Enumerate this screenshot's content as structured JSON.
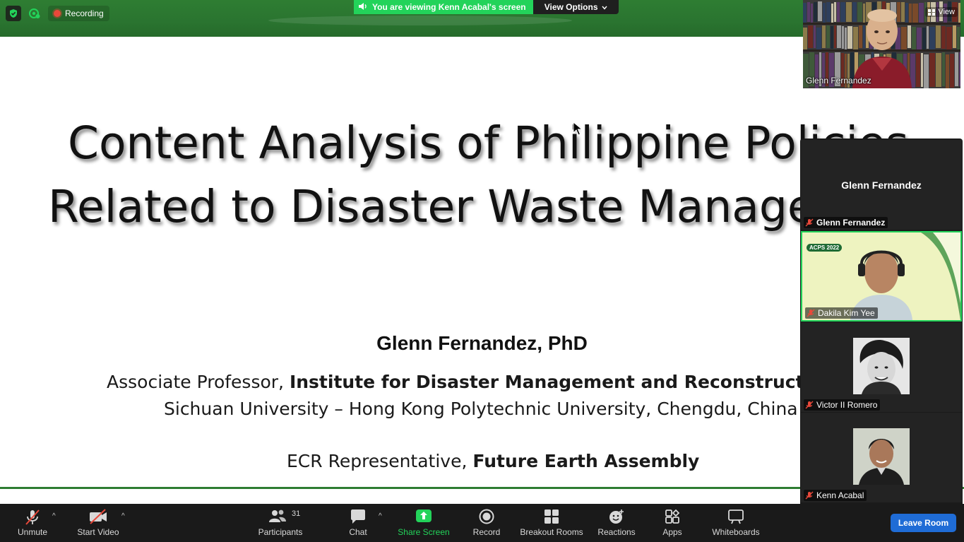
{
  "status": {
    "recording_label": "Recording"
  },
  "banner": {
    "viewing_text": "You are viewing Kenn Acabal's screen",
    "view_options_label": "View Options"
  },
  "speaker": {
    "name": "Glenn Fernandez",
    "view_label": "View"
  },
  "slide": {
    "title_line_1": "Content Analysis of Philippine Policies",
    "title_line_2": "Related to Disaster Waste Management",
    "presenter": "Glenn Fernandez, PhD",
    "affiliation_prefix": "Associate Professor, ",
    "affiliation_bold": "Institute for Disaster Management and Reconstruction (",
    "affiliation_line_2": "Sichuan University – Hong Kong Polytechnic University, Chengdu, China",
    "ecr_prefix": "ECR Representative, ",
    "ecr_bold": "Future Earth Assembly"
  },
  "gallery": {
    "tiles": [
      {
        "display_name": "Glenn Fernandez",
        "label": "Glenn Fernandez"
      },
      {
        "label": "Dakila Kim Yee",
        "badge": "ACPS 2022"
      },
      {
        "label": "Victor II Romero"
      },
      {
        "label": "Kenn Acabal"
      }
    ]
  },
  "toolbar": {
    "unmute": "Unmute",
    "start_video": "Start Video",
    "participants": "Participants",
    "participants_count": "31",
    "chat": "Chat",
    "share_screen": "Share Screen",
    "record": "Record",
    "breakout_rooms": "Breakout Rooms",
    "reactions": "Reactions",
    "apps": "Apps",
    "whiteboards": "Whiteboards",
    "leave_room": "Leave Room"
  },
  "colors": {
    "slide_green": "#2e7d32",
    "banner_green": "#23d35a",
    "leave_blue": "#1f6cd6",
    "toolbar_bg": "#1a1a1a"
  }
}
